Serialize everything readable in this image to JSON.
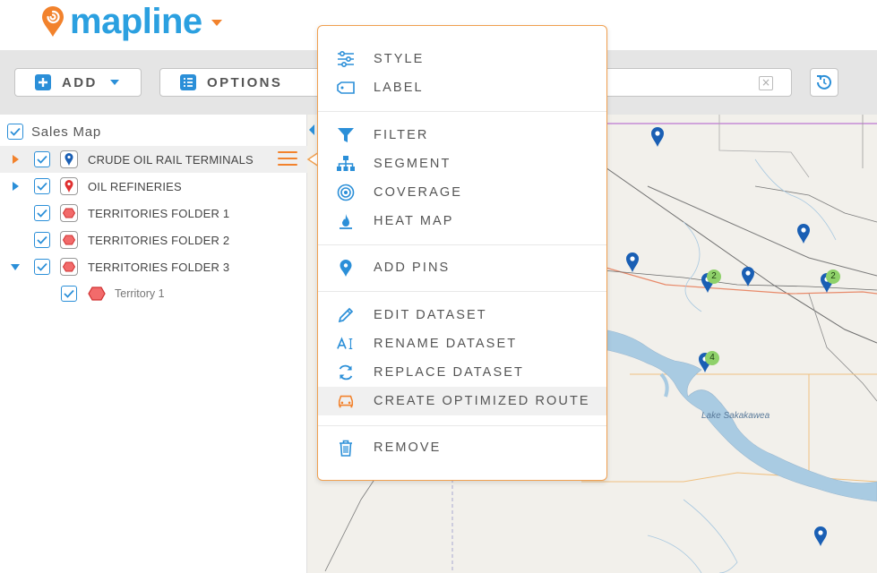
{
  "app": {
    "brand": "mapline",
    "brand_color": "#2ba0e0",
    "accent_color": "#f2822c"
  },
  "toolbar": {
    "add_label": "ADD",
    "options_label": "OPTIONS",
    "search_value": ""
  },
  "layers": {
    "map_name": "Sales Map",
    "items": [
      {
        "label": "CRUDE OIL RAIL TERMINALS",
        "checked": true,
        "icon": "pin-layer-icon-blue",
        "expander": "collapsed-orange",
        "active": true
      },
      {
        "label": "OIL REFINERIES",
        "checked": true,
        "icon": "pin-layer-icon-red",
        "expander": "collapsed"
      },
      {
        "label": "TERRITORIES FOLDER 1",
        "checked": true,
        "icon": "territory-folder-icon"
      },
      {
        "label": "TERRITORIES FOLDER 2",
        "checked": true,
        "icon": "territory-folder-icon"
      },
      {
        "label": "TERRITORIES FOLDER 3",
        "checked": true,
        "icon": "territory-folder-icon",
        "expander": "expanded"
      },
      {
        "label": "Territory 1",
        "checked": true,
        "icon": "territory-hexagon-icon",
        "indent": true
      }
    ]
  },
  "context_menu": {
    "groups": [
      [
        {
          "label": "STYLE",
          "icon": "sliders-icon"
        },
        {
          "label": "LABEL",
          "icon": "tag-icon"
        }
      ],
      [
        {
          "label": "FILTER",
          "icon": "funnel-icon"
        },
        {
          "label": "SEGMENT",
          "icon": "hierarchy-icon"
        },
        {
          "label": "COVERAGE",
          "icon": "target-icon"
        },
        {
          "label": "HEAT MAP",
          "icon": "flame-icon"
        }
      ],
      [
        {
          "label": "ADD PINS",
          "icon": "map-pin-icon"
        }
      ],
      [
        {
          "label": "EDIT DATASET",
          "icon": "pencil-icon"
        },
        {
          "label": "RENAME DATASET",
          "icon": "rename-text-icon"
        },
        {
          "label": "REPLACE DATASET",
          "icon": "refresh-icon"
        },
        {
          "label": "CREATE OPTIMIZED ROUTE",
          "icon": "car-route-icon",
          "highlighted": true
        }
      ],
      [
        {
          "label": "REMOVE",
          "icon": "trash-icon"
        }
      ]
    ]
  },
  "map": {
    "lake_label": "Lake Sakakawea",
    "clusters": [
      "2",
      "2",
      "4"
    ]
  }
}
